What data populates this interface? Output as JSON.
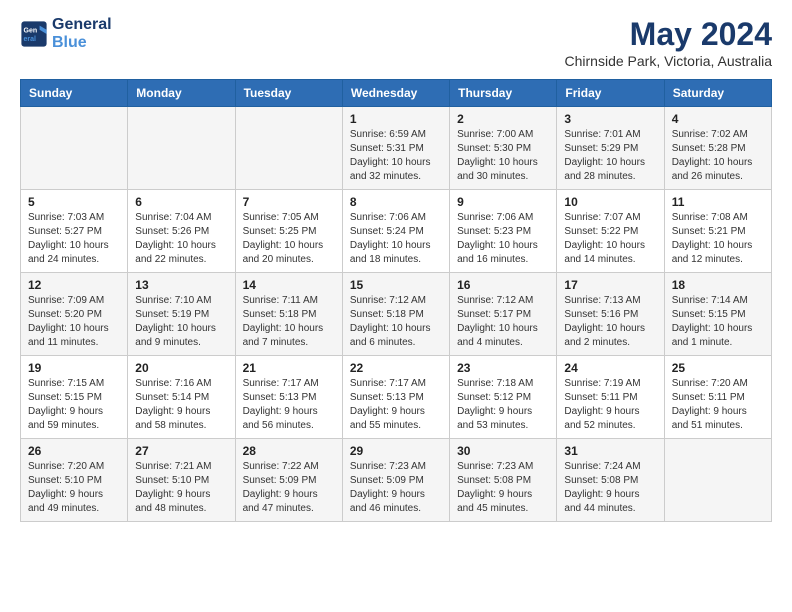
{
  "brand": {
    "line1": "General",
    "line2": "Blue"
  },
  "title": "May 2024",
  "location": "Chirnside Park, Victoria, Australia",
  "weekdays": [
    "Sunday",
    "Monday",
    "Tuesday",
    "Wednesday",
    "Thursday",
    "Friday",
    "Saturday"
  ],
  "weeks": [
    [
      {
        "day": "",
        "content": ""
      },
      {
        "day": "",
        "content": ""
      },
      {
        "day": "",
        "content": ""
      },
      {
        "day": "1",
        "content": "Sunrise: 6:59 AM\nSunset: 5:31 PM\nDaylight: 10 hours\nand 32 minutes."
      },
      {
        "day": "2",
        "content": "Sunrise: 7:00 AM\nSunset: 5:30 PM\nDaylight: 10 hours\nand 30 minutes."
      },
      {
        "day": "3",
        "content": "Sunrise: 7:01 AM\nSunset: 5:29 PM\nDaylight: 10 hours\nand 28 minutes."
      },
      {
        "day": "4",
        "content": "Sunrise: 7:02 AM\nSunset: 5:28 PM\nDaylight: 10 hours\nand 26 minutes."
      }
    ],
    [
      {
        "day": "5",
        "content": "Sunrise: 7:03 AM\nSunset: 5:27 PM\nDaylight: 10 hours\nand 24 minutes."
      },
      {
        "day": "6",
        "content": "Sunrise: 7:04 AM\nSunset: 5:26 PM\nDaylight: 10 hours\nand 22 minutes."
      },
      {
        "day": "7",
        "content": "Sunrise: 7:05 AM\nSunset: 5:25 PM\nDaylight: 10 hours\nand 20 minutes."
      },
      {
        "day": "8",
        "content": "Sunrise: 7:06 AM\nSunset: 5:24 PM\nDaylight: 10 hours\nand 18 minutes."
      },
      {
        "day": "9",
        "content": "Sunrise: 7:06 AM\nSunset: 5:23 PM\nDaylight: 10 hours\nand 16 minutes."
      },
      {
        "day": "10",
        "content": "Sunrise: 7:07 AM\nSunset: 5:22 PM\nDaylight: 10 hours\nand 14 minutes."
      },
      {
        "day": "11",
        "content": "Sunrise: 7:08 AM\nSunset: 5:21 PM\nDaylight: 10 hours\nand 12 minutes."
      }
    ],
    [
      {
        "day": "12",
        "content": "Sunrise: 7:09 AM\nSunset: 5:20 PM\nDaylight: 10 hours\nand 11 minutes."
      },
      {
        "day": "13",
        "content": "Sunrise: 7:10 AM\nSunset: 5:19 PM\nDaylight: 10 hours\nand 9 minutes."
      },
      {
        "day": "14",
        "content": "Sunrise: 7:11 AM\nSunset: 5:18 PM\nDaylight: 10 hours\nand 7 minutes."
      },
      {
        "day": "15",
        "content": "Sunrise: 7:12 AM\nSunset: 5:18 PM\nDaylight: 10 hours\nand 6 minutes."
      },
      {
        "day": "16",
        "content": "Sunrise: 7:12 AM\nSunset: 5:17 PM\nDaylight: 10 hours\nand 4 minutes."
      },
      {
        "day": "17",
        "content": "Sunrise: 7:13 AM\nSunset: 5:16 PM\nDaylight: 10 hours\nand 2 minutes."
      },
      {
        "day": "18",
        "content": "Sunrise: 7:14 AM\nSunset: 5:15 PM\nDaylight: 10 hours\nand 1 minute."
      }
    ],
    [
      {
        "day": "19",
        "content": "Sunrise: 7:15 AM\nSunset: 5:15 PM\nDaylight: 9 hours\nand 59 minutes."
      },
      {
        "day": "20",
        "content": "Sunrise: 7:16 AM\nSunset: 5:14 PM\nDaylight: 9 hours\nand 58 minutes."
      },
      {
        "day": "21",
        "content": "Sunrise: 7:17 AM\nSunset: 5:13 PM\nDaylight: 9 hours\nand 56 minutes."
      },
      {
        "day": "22",
        "content": "Sunrise: 7:17 AM\nSunset: 5:13 PM\nDaylight: 9 hours\nand 55 minutes."
      },
      {
        "day": "23",
        "content": "Sunrise: 7:18 AM\nSunset: 5:12 PM\nDaylight: 9 hours\nand 53 minutes."
      },
      {
        "day": "24",
        "content": "Sunrise: 7:19 AM\nSunset: 5:11 PM\nDaylight: 9 hours\nand 52 minutes."
      },
      {
        "day": "25",
        "content": "Sunrise: 7:20 AM\nSunset: 5:11 PM\nDaylight: 9 hours\nand 51 minutes."
      }
    ],
    [
      {
        "day": "26",
        "content": "Sunrise: 7:20 AM\nSunset: 5:10 PM\nDaylight: 9 hours\nand 49 minutes."
      },
      {
        "day": "27",
        "content": "Sunrise: 7:21 AM\nSunset: 5:10 PM\nDaylight: 9 hours\nand 48 minutes."
      },
      {
        "day": "28",
        "content": "Sunrise: 7:22 AM\nSunset: 5:09 PM\nDaylight: 9 hours\nand 47 minutes."
      },
      {
        "day": "29",
        "content": "Sunrise: 7:23 AM\nSunset: 5:09 PM\nDaylight: 9 hours\nand 46 minutes."
      },
      {
        "day": "30",
        "content": "Sunrise: 7:23 AM\nSunset: 5:08 PM\nDaylight: 9 hours\nand 45 minutes."
      },
      {
        "day": "31",
        "content": "Sunrise: 7:24 AM\nSunset: 5:08 PM\nDaylight: 9 hours\nand 44 minutes."
      },
      {
        "day": "",
        "content": ""
      }
    ]
  ]
}
